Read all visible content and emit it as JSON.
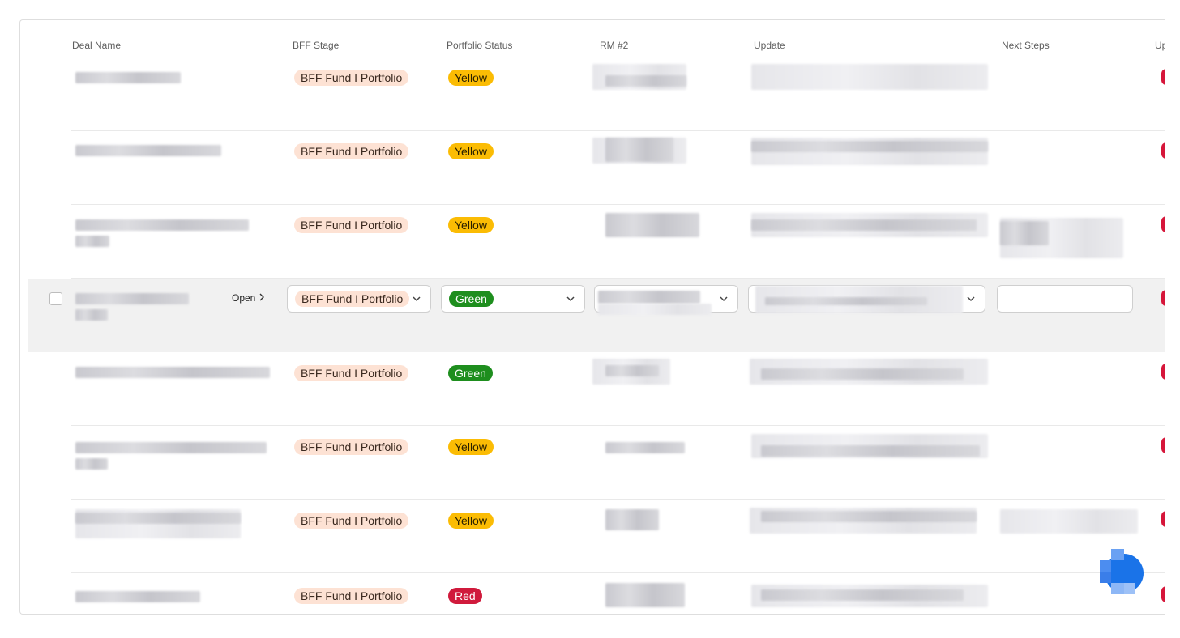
{
  "columns": {
    "deal_name": "Deal Name",
    "bff_stage": "BFF Stage",
    "portfolio_status": "Portfolio Status",
    "rm2": "RM #2",
    "update": "Update",
    "next_steps": "Next Steps",
    "cut_off": "Up"
  },
  "rows": [
    {
      "stage": "BFF Fund I Portfolio",
      "status": "Yellow",
      "status_color": "#fbbc04"
    },
    {
      "stage": "BFF Fund I Portfolio",
      "status": "Yellow",
      "status_color": "#fbbc04"
    },
    {
      "stage": "BFF Fund I Portfolio",
      "status": "Yellow",
      "status_color": "#fbbc04"
    },
    {
      "stage": "BFF Fund I Portfolio",
      "status": "Green",
      "status_color": "#1e8e1e",
      "selected": true
    },
    {
      "stage": "BFF Fund I Portfolio",
      "status": "Green",
      "status_color": "#1e8e1e"
    },
    {
      "stage": "BFF Fund I Portfolio",
      "status": "Yellow",
      "status_color": "#fbbc04"
    },
    {
      "stage": "BFF Fund I Portfolio",
      "status": "Yellow",
      "status_color": "#fbbc04"
    },
    {
      "stage": "BFF Fund I Portfolio",
      "status": "Red",
      "status_color": "#d01a3c"
    }
  ],
  "selected_row": {
    "open_label": "Open",
    "next_steps_value": ""
  },
  "icons": {
    "open": "chevron-right-icon",
    "dropdown": "chevron-down-icon",
    "fab": "app-launcher-icon"
  },
  "colors": {
    "stage_pill": "#fde2d4",
    "yellow": "#fbbc04",
    "green": "#1e8e1e",
    "red": "#d01a3c",
    "accent_dot": "#d6163a",
    "fab_blue": "#1a73e8"
  }
}
